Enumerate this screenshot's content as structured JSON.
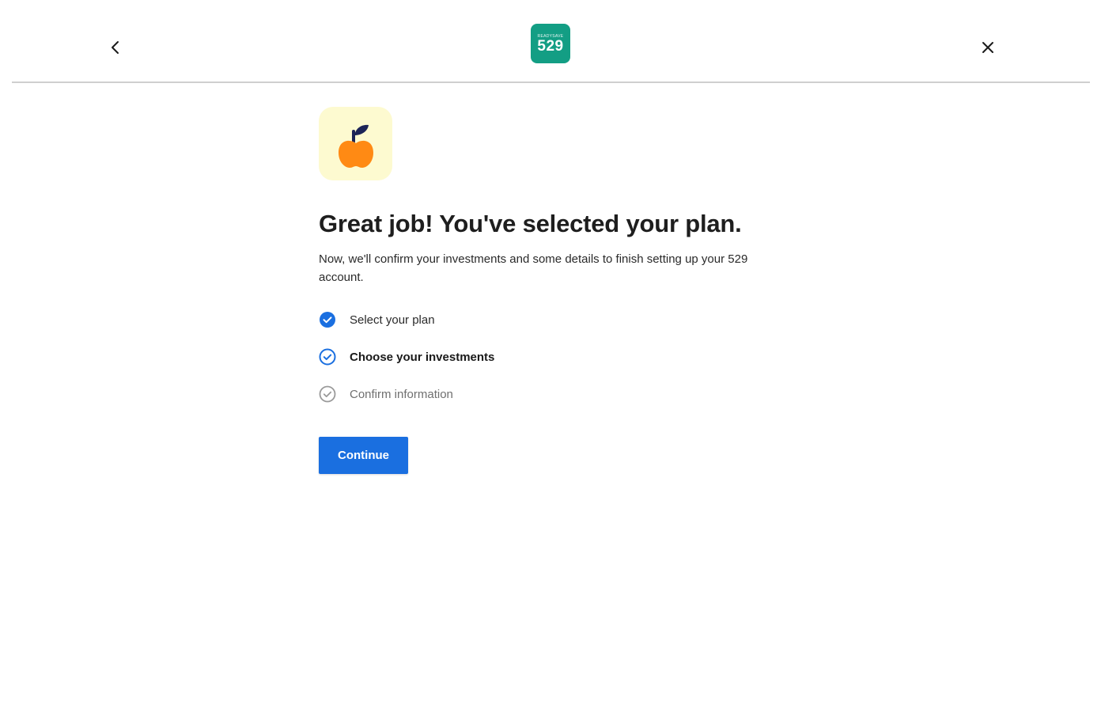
{
  "header": {
    "back_icon": "chevron-left-icon",
    "close_icon": "close-icon",
    "logo": {
      "small_text": "READYSAVE",
      "big_text": "529",
      "color": "#139e84"
    }
  },
  "main": {
    "hero_icon": "apple-icon",
    "title": "Great job! You've selected your plan.",
    "description": "Now, we'll confirm your investments and some details to finish setting up your 529 account.",
    "steps": [
      {
        "label": "Select your plan",
        "status": "complete"
      },
      {
        "label": "Choose your investments",
        "status": "active"
      },
      {
        "label": "Confirm information",
        "status": "pending"
      }
    ],
    "continue_label": "Continue"
  },
  "colors": {
    "accent": "#1a6fe0",
    "hero_bg": "#fdfad0",
    "apple": "#ff8a14",
    "leaf": "#1c2457"
  }
}
